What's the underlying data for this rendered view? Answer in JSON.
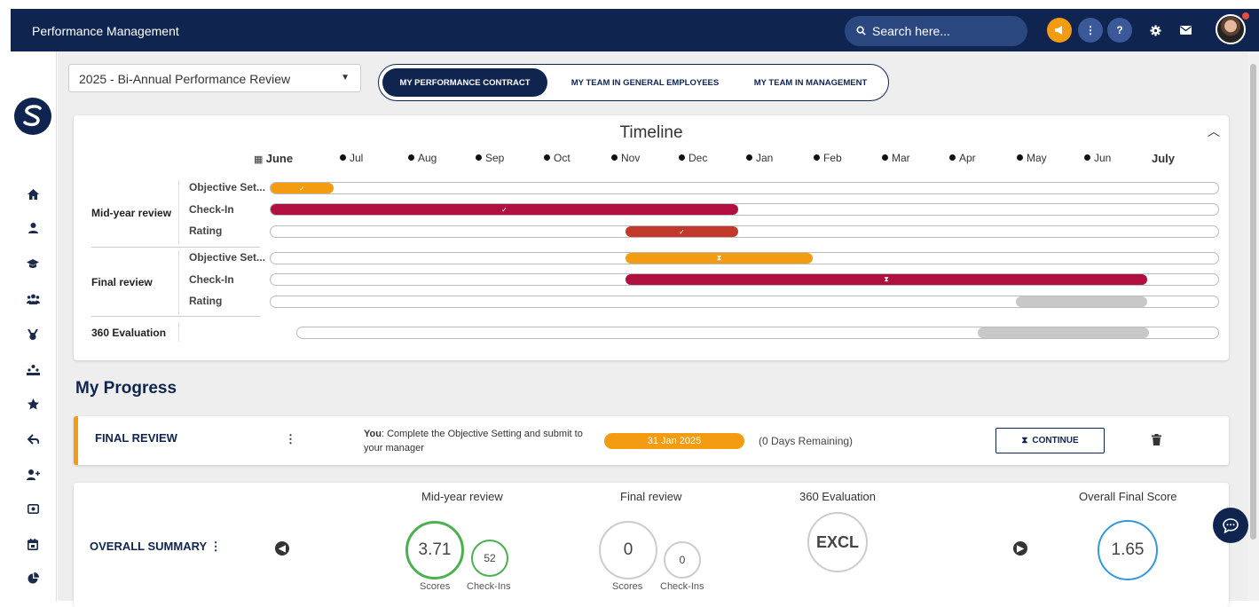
{
  "header": {
    "app_title": "Performance Management",
    "search_placeholder": "Search here...",
    "colors": {
      "bar": "#0f2550",
      "announce": "#f39c12",
      "help": "#3b5998"
    }
  },
  "sidebar": {
    "items": [
      {
        "icon": "home-icon"
      },
      {
        "icon": "user-icon"
      },
      {
        "icon": "graduation-cap-icon"
      },
      {
        "icon": "team-icon"
      },
      {
        "icon": "medal-icon"
      },
      {
        "icon": "org-chart-icon"
      },
      {
        "icon": "star-icon"
      },
      {
        "icon": "hand-icon"
      },
      {
        "icon": "add-user-icon"
      },
      {
        "icon": "money-icon"
      },
      {
        "icon": "calendar-icon"
      },
      {
        "icon": "pie-chart-icon"
      }
    ]
  },
  "filters": {
    "review_select": "2025 - Bi-Annual Performance Review"
  },
  "tabs": [
    {
      "label": "MY PERFORMANCE CONTRACT",
      "active": true
    },
    {
      "label": "MY TEAM IN GENERAL EMPLOYEES",
      "active": false
    },
    {
      "label": "MY TEAM IN MANAGEMENT",
      "active": false
    }
  ],
  "timeline": {
    "title": "Timeline",
    "months": [
      "June",
      "Jul",
      "Aug",
      "Sep",
      "Oct",
      "Nov",
      "Dec",
      "Jan",
      "Feb",
      "Mar",
      "Apr",
      "May",
      "Jun",
      "July"
    ],
    "groups": [
      {
        "label": "Mid-year review",
        "rows": [
          {
            "label": "Objective Set...",
            "status": "done",
            "color": "#f39c12"
          },
          {
            "label": "Check-In",
            "status": "done",
            "color": "#b0103f"
          },
          {
            "label": "Rating",
            "status": "done",
            "color": "#c0392b"
          }
        ]
      },
      {
        "label": "Final review",
        "rows": [
          {
            "label": "Objective Set...",
            "status": "pending",
            "color": "#f39c12"
          },
          {
            "label": "Check-In",
            "status": "pending",
            "color": "#b0103f"
          },
          {
            "label": "Rating",
            "status": "upcoming",
            "color": "#c8c8c8"
          }
        ]
      },
      {
        "label": "360 Evaluation",
        "rows": [
          {
            "label": "",
            "status": "upcoming",
            "color": "#c8c8c8"
          }
        ]
      }
    ]
  },
  "progress": {
    "heading": "My Progress",
    "final_review": {
      "title": "FINAL REVIEW",
      "you_label": "You",
      "message": ": Complete the Objective Setting and submit to your manager",
      "due_date": "31 Jan 2025",
      "remaining": "(0 Days Remaining)",
      "continue_label": "CONTINUE"
    }
  },
  "summary": {
    "title": "OVERALL SUMMARY",
    "mid_year": {
      "heading": "Mid-year review",
      "score": "3.71",
      "checkins": "52",
      "score_caption": "Scores",
      "checkins_caption": "Check-Ins"
    },
    "final": {
      "heading": "Final review",
      "score": "0",
      "checkins": "0",
      "score_caption": "Scores",
      "checkins_caption": "Check-Ins"
    },
    "evaluation_360": {
      "heading": "360 Evaluation",
      "value": "EXCL"
    },
    "overall": {
      "heading": "Overall Final Score",
      "value": "1.65"
    }
  }
}
